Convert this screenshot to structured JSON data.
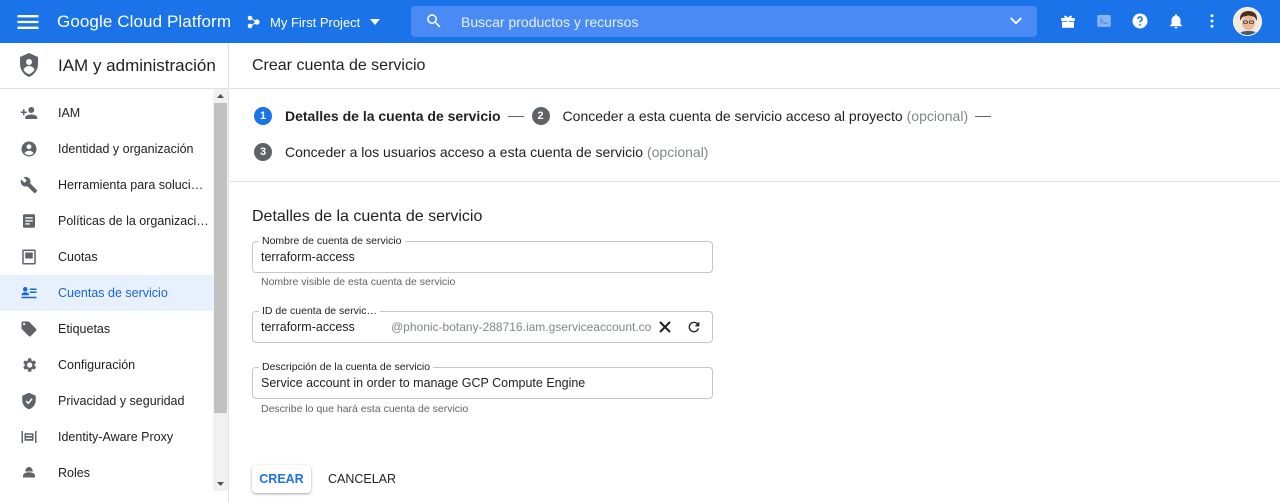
{
  "topbar": {
    "brand": "Google Cloud Platform",
    "project": "My First Project",
    "search_placeholder": "Buscar productos y recursos",
    "color": "#1a73e8"
  },
  "sidebar": {
    "title": "IAM y administración",
    "items": [
      {
        "label": "IAM",
        "icon": "person-add-icon"
      },
      {
        "label": "Identidad y organización",
        "icon": "account-circle-icon"
      },
      {
        "label": "Herramienta para soluci…",
        "icon": "wrench-icon"
      },
      {
        "label": "Políticas de la organizaci…",
        "icon": "policy-document-icon"
      },
      {
        "label": "Cuotas",
        "icon": "quota-icon"
      },
      {
        "label": "Cuentas de servicio",
        "icon": "service-account-icon",
        "active": true
      },
      {
        "label": "Etiquetas",
        "icon": "label-tag-icon"
      },
      {
        "label": "Configuración",
        "icon": "settings-gear-icon"
      },
      {
        "label": "Privacidad y seguridad",
        "icon": "shield-check-icon"
      },
      {
        "label": "Identity-Aware Proxy",
        "icon": "proxy-icon"
      },
      {
        "label": "Roles",
        "icon": "roles-icon"
      }
    ]
  },
  "main": {
    "title": "Crear cuenta de servicio",
    "steps": [
      {
        "num": "1",
        "label": "Detalles de la cuenta de servicio",
        "optional": ""
      },
      {
        "num": "2",
        "label": "Conceder a esta cuenta de servicio acceso al proyecto",
        "optional": "(opcional)"
      },
      {
        "num": "3",
        "label": "Conceder a los usuarios acceso a esta cuenta de servicio",
        "optional": "(opcional)"
      }
    ],
    "section_title": "Detalles de la cuenta de servicio",
    "fields": {
      "name": {
        "label": "Nombre de cuenta de servicio",
        "value": "terraform-access",
        "hint": "Nombre visible de esta cuenta de servicio"
      },
      "id": {
        "label": "ID de cuenta de servic…",
        "value": "terraform-access",
        "suffix": "@phonic-botany-288716.iam.gserviceaccount.co"
      },
      "description": {
        "label": "Descripción de la cuenta de servicio",
        "value": "Service account in order to manage GCP Compute Engine",
        "hint": "Describe lo que hará esta cuenta de servicio"
      }
    },
    "buttons": {
      "create": "CREAR",
      "cancel": "CANCELAR"
    }
  }
}
